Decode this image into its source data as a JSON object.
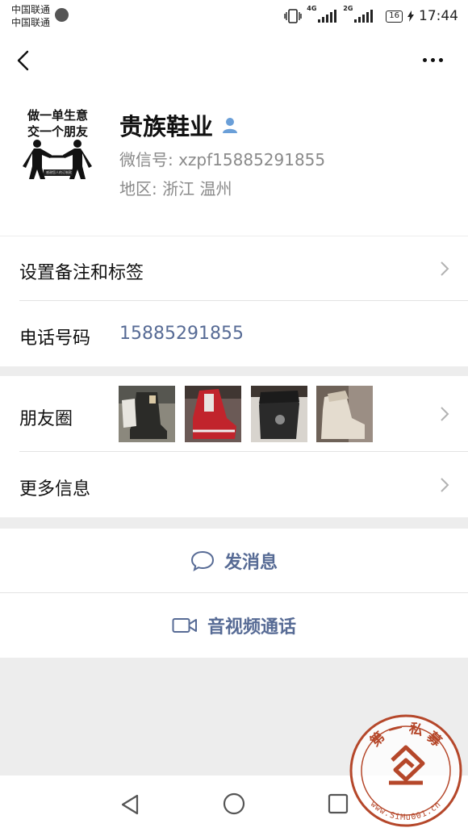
{
  "status_bar": {
    "carrier_1": "中国联通",
    "carrier_2": "中国联通",
    "network_1": "4G",
    "network_2": "2G",
    "battery": "16",
    "time": "17:44"
  },
  "profile": {
    "avatar_text_1": "做一单生意",
    "avatar_text_2": "交一个朋友",
    "avatar_caption": "感谢您人的订制款",
    "name": "贵族鞋业",
    "wechat_id": "微信号:  xzpf15885291855",
    "region": "地区:  浙江  温州"
  },
  "rows": {
    "remark_label": "设置备注和标签",
    "phone_label": "电话号码",
    "phone_value": "15885291855",
    "moments_label": "朋友圈",
    "more_info_label": "更多信息"
  },
  "actions": {
    "message_label": "发消息",
    "call_label": "音视频通话"
  },
  "watermark": {
    "text_top": "第 一 私 募",
    "text_bottom": "www.SiMu001.cn"
  },
  "colors": {
    "link": "#576b95",
    "background": "#ededed",
    "watermark": "#b5472a"
  },
  "icons": [
    "back-arrow-icon",
    "more-dots-icon",
    "person-verified-icon",
    "chevron-right-icon",
    "chat-bubble-icon",
    "video-camera-icon",
    "nav-back-triangle-icon",
    "nav-home-circle-icon",
    "nav-recents-square-icon"
  ]
}
